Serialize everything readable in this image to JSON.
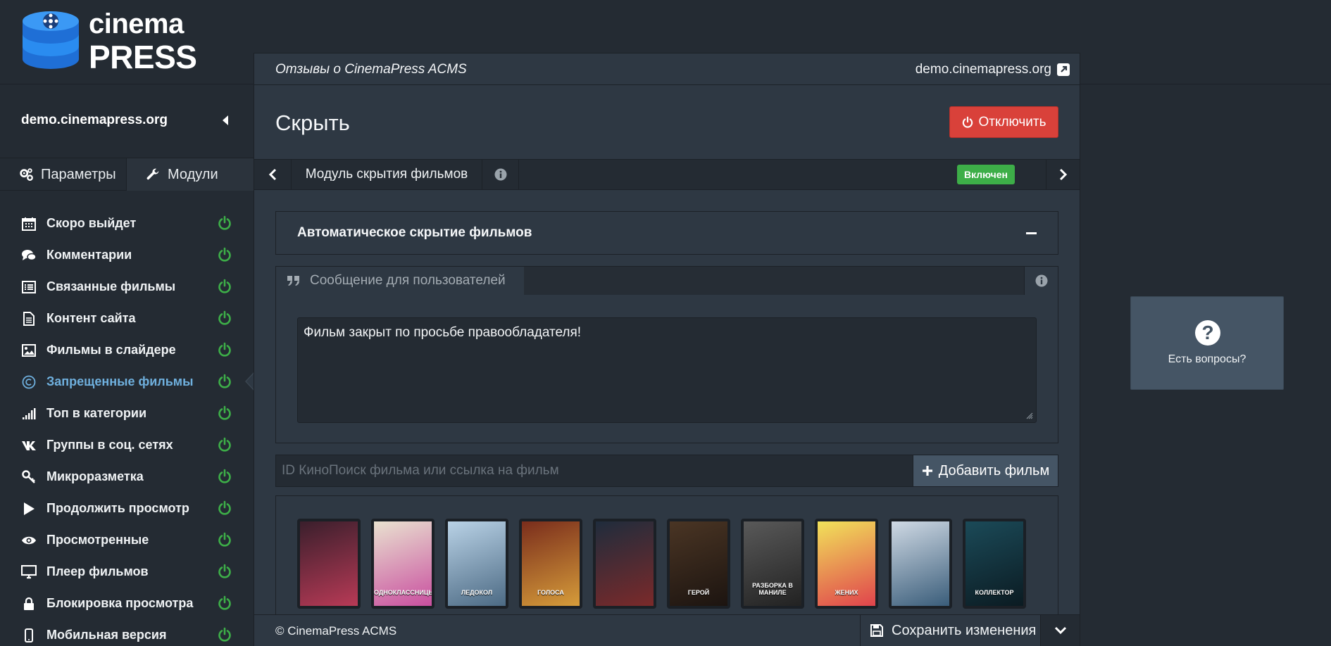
{
  "logo": {
    "line1": "cinema",
    "line2": "PRESS"
  },
  "sidebar": {
    "site_name": "demo.cinemapress.org",
    "tabs": [
      {
        "label": "Параметры",
        "icon": "gears-icon"
      },
      {
        "label": "Модули",
        "icon": "wrench-icon"
      }
    ],
    "items": [
      {
        "label": "Скоро выйдет",
        "icon": "calendar-icon",
        "enabled": true
      },
      {
        "label": "Комментарии",
        "icon": "comments-icon",
        "enabled": true
      },
      {
        "label": "Связанные фильмы",
        "icon": "list-icon",
        "enabled": true
      },
      {
        "label": "Контент сайта",
        "icon": "document-icon",
        "enabled": true
      },
      {
        "label": "Фильмы в слайдере",
        "icon": "image-icon",
        "enabled": true
      },
      {
        "label": "Запрещенные фильмы",
        "icon": "copyright-icon",
        "enabled": true,
        "active": true
      },
      {
        "label": "Топ в категории",
        "icon": "signal-icon",
        "enabled": true
      },
      {
        "label": "Группы в соц. сетях",
        "icon": "vk-icon",
        "enabled": true
      },
      {
        "label": "Микроразметка",
        "icon": "key-icon",
        "enabled": true
      },
      {
        "label": "Продолжить просмотр",
        "icon": "play-icon",
        "enabled": true
      },
      {
        "label": "Просмотренные",
        "icon": "eye-icon",
        "enabled": true
      },
      {
        "label": "Плеер фильмов",
        "icon": "monitor-icon",
        "enabled": true
      },
      {
        "label": "Блокировка просмотра",
        "icon": "lock-icon",
        "enabled": true
      },
      {
        "label": "Мобильная версия",
        "icon": "mobile-icon",
        "enabled": true
      }
    ]
  },
  "header": {
    "title": "Отзывы о CinemaPress ACMS",
    "site_link": "demo.cinemapress.org"
  },
  "page": {
    "title": "Скрыть",
    "disable_button": "Отключить",
    "module_name": "Модуль скрытия фильмов",
    "status": "Включен",
    "status_color": "#3dae48"
  },
  "auto_hide": {
    "title": "Автоматическое скрытие фильмов"
  },
  "message": {
    "label": "Сообщение для пользователей",
    "value": "Фильм закрыт по просьбе правообладателя!"
  },
  "add_film": {
    "placeholder": "ID КиноПоиск фильма или ссылка на фильм",
    "button": "Добавить фильм"
  },
  "posters": [
    {
      "caption": "",
      "colors": [
        "#3a1f2c",
        "#b83a56"
      ]
    },
    {
      "caption": "ОДНОКЛАССНИЦЫ",
      "colors": [
        "#e9e2d0",
        "#c94f9f"
      ]
    },
    {
      "caption": "ЛЕДОКОЛ",
      "colors": [
        "#b9d2e6",
        "#4c6a84"
      ]
    },
    {
      "caption": "ГОЛОСА",
      "colors": [
        "#7a2d1c",
        "#d69c3a"
      ]
    },
    {
      "caption": "",
      "colors": [
        "#1f2c3c",
        "#7b2a2a"
      ]
    },
    {
      "caption": "ГЕРОЙ",
      "colors": [
        "#4a3524",
        "#1c1410"
      ]
    },
    {
      "caption": "РАЗБОРКА В МАНИЛЕ",
      "colors": [
        "#595959",
        "#222222"
      ]
    },
    {
      "caption": "ЖЕНИХ",
      "colors": [
        "#f1e25a",
        "#e0434c"
      ]
    },
    {
      "caption": "",
      "colors": [
        "#cfd9e4",
        "#3a5d7a"
      ]
    },
    {
      "caption": "КОЛЛЕКТОР",
      "colors": [
        "#1b4a58",
        "#0b1b22"
      ]
    }
  ],
  "footer": {
    "copyright": "© CinemaPress ACMS",
    "save_button": "Сохранить изменения"
  },
  "help": {
    "label": "Есть вопросы?"
  },
  "colors": {
    "background": "#242b33",
    "panel": "#2e3843",
    "accent_green": "#3dae48",
    "danger": "#d9413a",
    "active_link": "#6fb0de"
  }
}
